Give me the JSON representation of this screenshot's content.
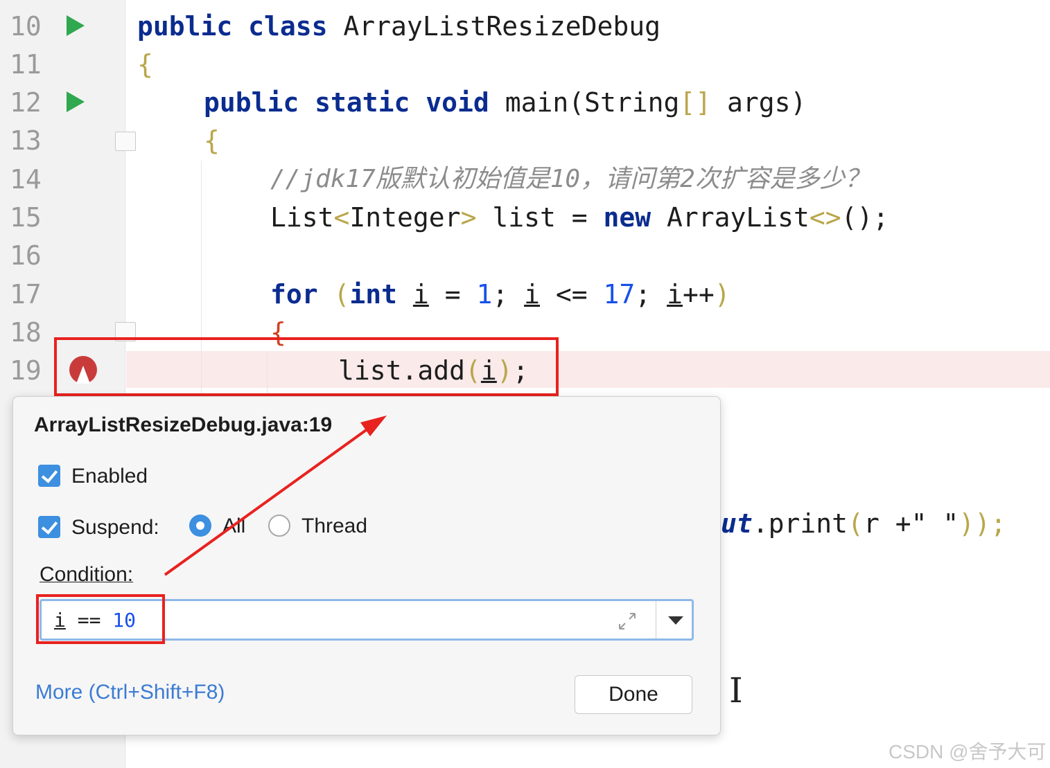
{
  "editor": {
    "line_numbers": [
      "10",
      "11",
      "12",
      "13",
      "14",
      "15",
      "16",
      "17",
      "18",
      "19"
    ],
    "code": {
      "l10_kw": "public class",
      "l10_rest": " ArrayListResizeDebug",
      "l11": "{",
      "l12_kw": "public static void",
      "l12_rest1": " main(String",
      "l12_brackets": "[]",
      "l12_rest2": " args)",
      "l13": "{",
      "l14_comment": "//jdk17版默认初始值是10，请问第2次扩容是多少？",
      "l15_a": "List",
      "l15_b": "<",
      "l15_c": "Integer",
      "l15_d": ">",
      "l15_e": " list = ",
      "l15_new": "new",
      "l15_f": " ArrayList",
      "l15_g": "<>",
      "l15_h": "();",
      "l17_for": "for",
      "l17_paren": " (",
      "l17_int": "int",
      "l17_sp1": " ",
      "l17_i1": "i",
      "l17_eq": " = ",
      "l17_one": "1",
      "l17_semi1": "; ",
      "l17_i2": "i",
      "l17_le": " <= ",
      "l17_seventeen": "17",
      "l17_semi2": "; ",
      "l17_i3": "i",
      "l17_pp": "++",
      "l17_close": ")",
      "l18": "{",
      "l19_a": "list.add",
      "l19_b": "(",
      "l19_i": "i",
      "l19_c": ")",
      "l19_d": ";",
      "partial_a": "ut",
      "partial_b": ".print",
      "partial_c": "(",
      "partial_d": "r +\" \"",
      "partial_e": "));"
    }
  },
  "breakpoint_popup": {
    "title": "ArrayListResizeDebug.java:19",
    "enabled_label": "Enabled",
    "suspend_label": "Suspend:",
    "suspend_all_label": "All",
    "suspend_thread_label": "Thread",
    "condition_label": "Condition:",
    "condition_value_i": "i",
    "condition_value_op": " == ",
    "condition_value_num": "10",
    "more_link": "More (Ctrl+Shift+F8)",
    "done_button": "Done"
  },
  "watermark": "CSDN @舍予大可",
  "colors": {
    "annotation_red": "#e8221f",
    "keyword": "#0b2c8f",
    "number": "#1750eb",
    "checkbox": "#3d8fe0"
  }
}
